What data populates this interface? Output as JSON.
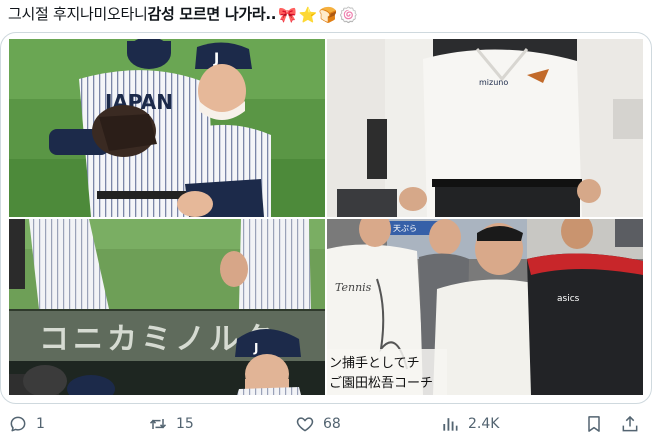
{
  "tweet": {
    "text_normal": "그시절 후지나미오타니",
    "text_bold": "감성 모르면 나가라..",
    "emojis": [
      "🎀",
      "⭐",
      "🍞",
      "🍥"
    ]
  },
  "media": {
    "photo1": {
      "jersey_text": "JAPAN",
      "cap_letter": "J"
    },
    "photo2": {
      "brand_text": "mizuno"
    },
    "photo3": {
      "banner_text": "コニカミノルタ",
      "cap_letter": "J"
    },
    "photo4": {
      "caption_line1": "ン捕手としてチ",
      "caption_line2": "ご園田松吾コーチ",
      "shirt_text": "asics",
      "sign_text": "天ぷら"
    }
  },
  "actions": {
    "reply_count": "1",
    "repost_count": "15",
    "like_count": "68",
    "views_count": "2.4K"
  },
  "colors": {
    "icon_gray": "#536471",
    "border": "#cfd9de",
    "field_green": "#4f8a3b",
    "navy": "#1c2a4a"
  }
}
